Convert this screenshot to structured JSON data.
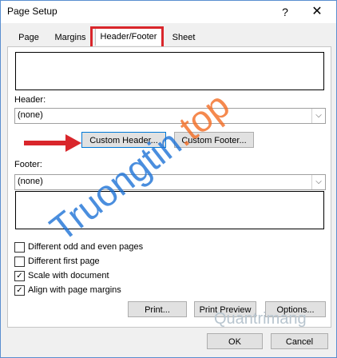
{
  "window": {
    "title": "Page Setup",
    "help": "?",
    "close": "✕"
  },
  "tabs": [
    {
      "label": "Page"
    },
    {
      "label": "Margins"
    },
    {
      "label": "Header/Footer"
    },
    {
      "label": "Sheet"
    }
  ],
  "header": {
    "label": "Header:",
    "value": "(none)"
  },
  "footer": {
    "label": "Footer:",
    "value": "(none)"
  },
  "buttons": {
    "custom_header": "Custom Header...",
    "custom_footer": "Custom Footer...",
    "print": "Print...",
    "print_preview": "Print Preview",
    "options": "Options...",
    "ok": "OK",
    "cancel": "Cancel"
  },
  "options": [
    {
      "label": "Different odd and even pages",
      "checked": false
    },
    {
      "label": "Different first page",
      "checked": false
    },
    {
      "label": "Scale with document",
      "checked": true
    },
    {
      "label": "Align with page margins",
      "checked": true
    }
  ],
  "watermark": {
    "site_main": "Truongtin",
    "site_tail": ".top",
    "small": "Quantrimang"
  },
  "colors": {
    "highlight": "#d9262b",
    "arrow": "#d9262b"
  }
}
